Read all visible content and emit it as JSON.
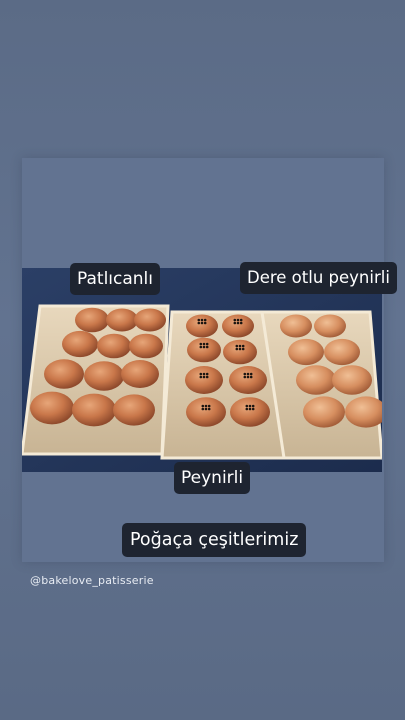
{
  "story": {
    "labels": {
      "left": "Patlıcanlı",
      "right": "Dere otlu peynirli",
      "middle": "Peynirli",
      "title": "Poğaça çeşitlerimiz"
    },
    "handle": "@bakelove_patisserie"
  },
  "colors": {
    "background": "#5e6f8a",
    "label_bg": "#1e2430",
    "label_text": "#ffffff"
  }
}
